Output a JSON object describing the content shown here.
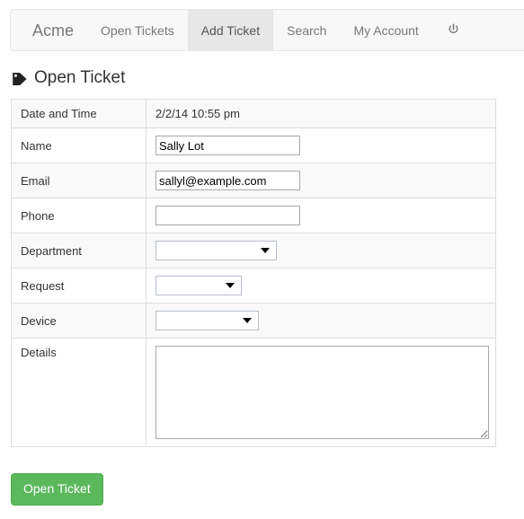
{
  "navbar": {
    "brand": "Acme",
    "items": [
      {
        "label": "Open Tickets",
        "active": false
      },
      {
        "label": "Add Ticket",
        "active": true
      },
      {
        "label": "Search",
        "active": false
      },
      {
        "label": "My Account",
        "active": false
      }
    ],
    "logout_icon": "power-icon",
    "background": "#f8f8f8",
    "active_background": "#e7e7e7",
    "text_color": "#777777"
  },
  "heading": {
    "icon": "tag-icon",
    "title": "Open Ticket"
  },
  "form": {
    "rows": [
      {
        "label": "Date and Time",
        "type": "text",
        "value": "2/2/14 10:55 pm"
      },
      {
        "label": "Name",
        "type": "input",
        "value": "Sally Lot"
      },
      {
        "label": "Email",
        "type": "input",
        "value": "sallyl@example.com"
      },
      {
        "label": "Phone",
        "type": "input",
        "value": ""
      },
      {
        "label": "Department",
        "type": "select",
        "value": ""
      },
      {
        "label": "Request",
        "type": "select",
        "value": ""
      },
      {
        "label": "Device",
        "type": "select",
        "value": ""
      },
      {
        "label": "Details",
        "type": "textarea",
        "value": ""
      }
    ]
  },
  "submit": {
    "label": "Open Ticket",
    "color": "#5cb85c"
  }
}
